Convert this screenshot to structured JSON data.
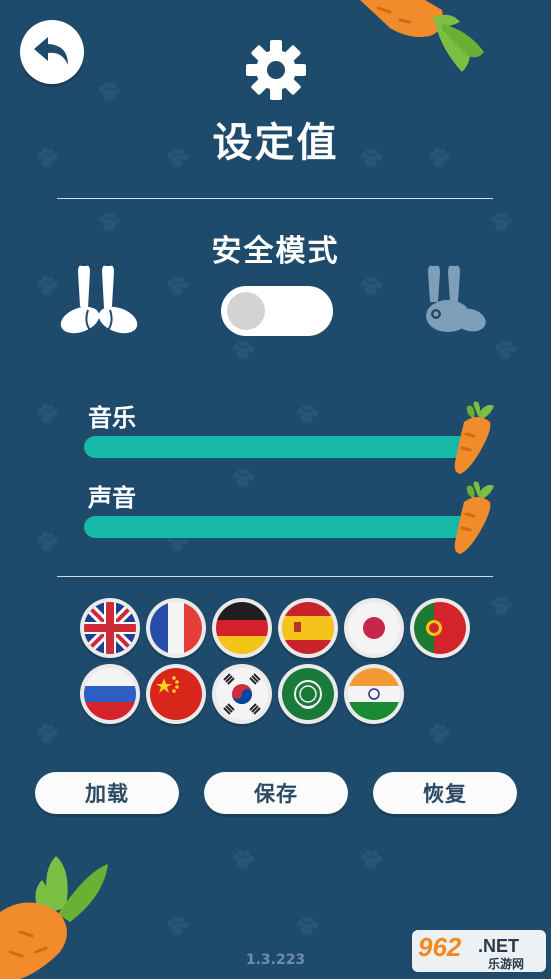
{
  "header": {
    "title": "设定值",
    "back_icon": "back-arrow-icon",
    "settings_icon": "gear-icon"
  },
  "safe_mode": {
    "label": "安全模式",
    "enabled": false
  },
  "audio": {
    "music_label": "音乐",
    "music_level": 1.0,
    "sound_label": "声音",
    "sound_level": 1.0
  },
  "languages": [
    "English",
    "Français",
    "Deutsch",
    "Español",
    "日本語",
    "Português",
    "Русский",
    "中文",
    "한국어",
    "العربية",
    "हिन्दी"
  ],
  "buttons": {
    "load": "加载",
    "save": "保存",
    "restore": "恢复"
  },
  "version": "1.3.223",
  "watermark": {
    "number": "962",
    "net": ".NET",
    "subtitle": "乐游网"
  },
  "colors": {
    "background": "#1e4a6b",
    "slider": "#16b8a8",
    "carrot": "#f28b2b",
    "leaf": "#7cc043"
  }
}
